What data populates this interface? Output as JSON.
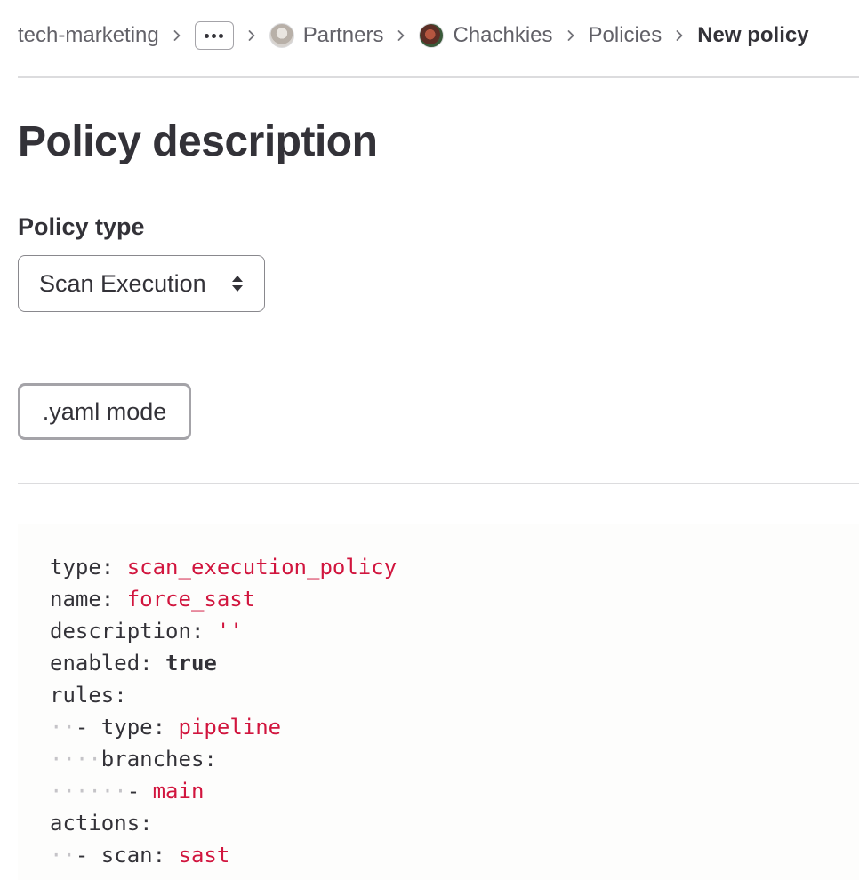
{
  "breadcrumb": {
    "items": [
      {
        "label": "tech-marketing"
      },
      {
        "label": "Partners"
      },
      {
        "label": "Chachkies"
      },
      {
        "label": "Policies"
      },
      {
        "label": "New policy"
      }
    ],
    "separator_icon": "chevron-right-icon",
    "more_icon": "ellipsis-icon"
  },
  "page": {
    "title": "Policy description"
  },
  "policy_type": {
    "label": "Policy type",
    "selected": "Scan Execution"
  },
  "yaml_mode_button": {
    "label": ".yaml mode"
  },
  "editor": {
    "lines": [
      {
        "indent": "",
        "key": "type:",
        "value": "scan_execution_policy",
        "style": "string"
      },
      {
        "indent": "",
        "key": "name:",
        "value": "force_sast",
        "style": "string"
      },
      {
        "indent": "",
        "key": "description:",
        "value": "''",
        "style": "string"
      },
      {
        "indent": "",
        "key": "enabled:",
        "value": "true",
        "style": "bool"
      },
      {
        "indent": "",
        "key": "rules:",
        "value": "",
        "style": "none"
      },
      {
        "indent": "··",
        "key": "- type:",
        "value": "pipeline",
        "style": "string"
      },
      {
        "indent": "····",
        "key": "branches:",
        "value": "",
        "style": "none"
      },
      {
        "indent": "······",
        "key": "- ",
        "value": "main",
        "style": "string"
      },
      {
        "indent": "",
        "key": "actions:",
        "value": "",
        "style": "none"
      },
      {
        "indent": "··",
        "key": "- scan:",
        "value": "sast",
        "style": "string"
      }
    ]
  },
  "colors": {
    "text": "#333238",
    "muted": "#626168",
    "yaml_value": "#d1153e",
    "border": "#89888d"
  }
}
